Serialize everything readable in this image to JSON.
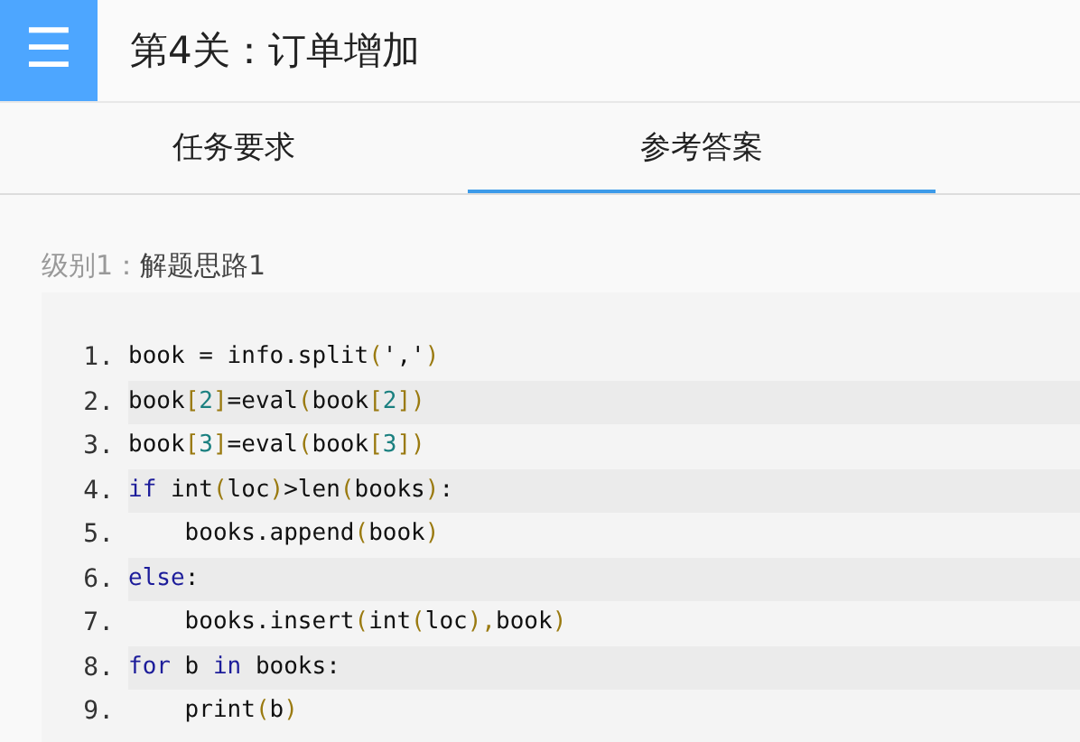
{
  "header": {
    "menu_icon": "☰",
    "title": "第4关：订单增加"
  },
  "tabs": [
    {
      "label": "任务要求",
      "selected": false
    },
    {
      "label": "参考答案",
      "selected": true
    }
  ],
  "solution": {
    "level_label": "级别1：",
    "title": "解题思路1"
  },
  "code": {
    "lines": [
      {
        "number": "1.",
        "tokens": [
          {
            "text": "book = info.split",
            "kind": "plain"
          },
          {
            "text": "(",
            "kind": "bracket"
          },
          {
            "text": "','",
            "kind": "plain"
          },
          {
            "text": ")",
            "kind": "bracket"
          }
        ]
      },
      {
        "number": "2.",
        "tokens": [
          {
            "text": "book",
            "kind": "plain"
          },
          {
            "text": "[",
            "kind": "bracket"
          },
          {
            "text": "2",
            "kind": "number"
          },
          {
            "text": "]",
            "kind": "bracket"
          },
          {
            "text": "=eval",
            "kind": "plain"
          },
          {
            "text": "(",
            "kind": "bracket"
          },
          {
            "text": "book",
            "kind": "plain"
          },
          {
            "text": "[",
            "kind": "bracket"
          },
          {
            "text": "2",
            "kind": "number"
          },
          {
            "text": "])",
            "kind": "bracket"
          }
        ]
      },
      {
        "number": "3.",
        "tokens": [
          {
            "text": "book",
            "kind": "plain"
          },
          {
            "text": "[",
            "kind": "bracket"
          },
          {
            "text": "3",
            "kind": "number"
          },
          {
            "text": "]",
            "kind": "bracket"
          },
          {
            "text": "=eval",
            "kind": "plain"
          },
          {
            "text": "(",
            "kind": "bracket"
          },
          {
            "text": "book",
            "kind": "plain"
          },
          {
            "text": "[",
            "kind": "bracket"
          },
          {
            "text": "3",
            "kind": "number"
          },
          {
            "text": "])",
            "kind": "bracket"
          }
        ]
      },
      {
        "number": "4.",
        "tokens": [
          {
            "text": "if",
            "kind": "keyword"
          },
          {
            "text": " int",
            "kind": "plain"
          },
          {
            "text": "(",
            "kind": "bracket"
          },
          {
            "text": "loc",
            "kind": "plain"
          },
          {
            "text": ")",
            "kind": "bracket"
          },
          {
            "text": ">len",
            "kind": "plain"
          },
          {
            "text": "(",
            "kind": "bracket"
          },
          {
            "text": "books",
            "kind": "plain"
          },
          {
            "text": ")",
            "kind": "bracket"
          },
          {
            "text": ":",
            "kind": "plain"
          }
        ]
      },
      {
        "number": "5.",
        "tokens": [
          {
            "text": "    books.append",
            "kind": "plain"
          },
          {
            "text": "(",
            "kind": "bracket"
          },
          {
            "text": "book",
            "kind": "plain"
          },
          {
            "text": ")",
            "kind": "bracket"
          }
        ]
      },
      {
        "number": "6.",
        "tokens": [
          {
            "text": "else",
            "kind": "keyword"
          },
          {
            "text": ":",
            "kind": "plain"
          }
        ]
      },
      {
        "number": "7.",
        "tokens": [
          {
            "text": "    books.insert",
            "kind": "plain"
          },
          {
            "text": "(",
            "kind": "bracket"
          },
          {
            "text": "int",
            "kind": "plain"
          },
          {
            "text": "(",
            "kind": "bracket"
          },
          {
            "text": "loc",
            "kind": "plain"
          },
          {
            "text": "),",
            "kind": "bracket"
          },
          {
            "text": "book",
            "kind": "plain"
          },
          {
            "text": ")",
            "kind": "bracket"
          }
        ]
      },
      {
        "number": "8.",
        "tokens": [
          {
            "text": "for",
            "kind": "keyword"
          },
          {
            "text": " b ",
            "kind": "plain"
          },
          {
            "text": "in",
            "kind": "keyword"
          },
          {
            "text": " books:",
            "kind": "plain"
          }
        ]
      },
      {
        "number": "9.",
        "tokens": [
          {
            "text": "    print",
            "kind": "plain"
          },
          {
            "text": "(",
            "kind": "bracket"
          },
          {
            "text": "b",
            "kind": "plain"
          },
          {
            "text": ")",
            "kind": "bracket"
          }
        ]
      }
    ]
  }
}
